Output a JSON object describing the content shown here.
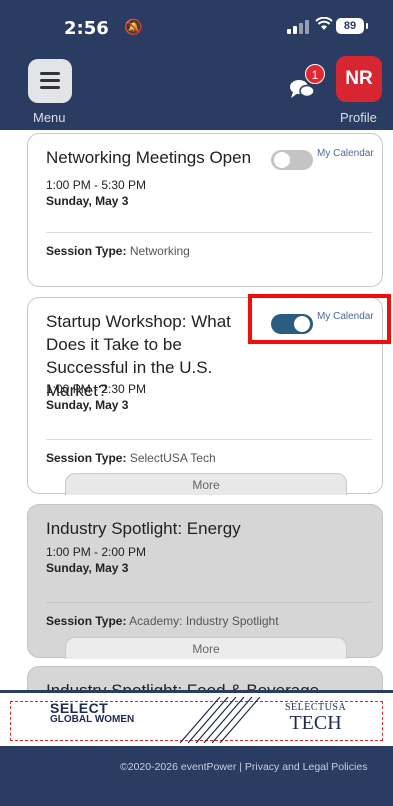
{
  "status_bar": {
    "time": "2:56",
    "battery": "89"
  },
  "header": {
    "menu_label": "Menu",
    "profile_initials": "NR",
    "profile_label": "Profile",
    "chat_badge_count": "1"
  },
  "sessions": [
    {
      "title": "Networking Meetings Open",
      "time": "1:00 PM - 5:30 PM",
      "day": "Sunday, May 3",
      "session_type_label": "Session Type:",
      "session_type": "Networking",
      "calendar_label": "My Calendar",
      "calendar_on": false
    },
    {
      "title": "Startup Workshop: What Does it Take to be Successful in the U.S. Market?",
      "time": "1:00 PM - 2:30 PM",
      "day": "Sunday, May 3",
      "session_type_label": "Session Type:",
      "session_type": "SelectUSA Tech",
      "calendar_label": "My Calendar",
      "calendar_on": true,
      "more_label": "More"
    },
    {
      "title": "Industry Spotlight: Energy",
      "time": "1:00 PM - 2:00 PM",
      "day": "Sunday, May 3",
      "session_type_label": "Session Type:",
      "session_type": "Academy: Industry Spotlight",
      "more_label": "More"
    },
    {
      "title": "Industry Spotlight: Food & Beverage"
    }
  ],
  "sponsors": {
    "global_women_line1": "SELECT",
    "global_women_line2": "GLOBAL WOMEN",
    "tech_line1": "SELECTUSA",
    "tech_line2": "TECH"
  },
  "footer": {
    "text": "©2020-2026 eventPower | Privacy and Legal Policies"
  },
  "colors": {
    "navy": "#2b3c62",
    "brand_red": "#d72631",
    "toggle_on": "#2a5d80",
    "highlight": "#f20c0c"
  }
}
